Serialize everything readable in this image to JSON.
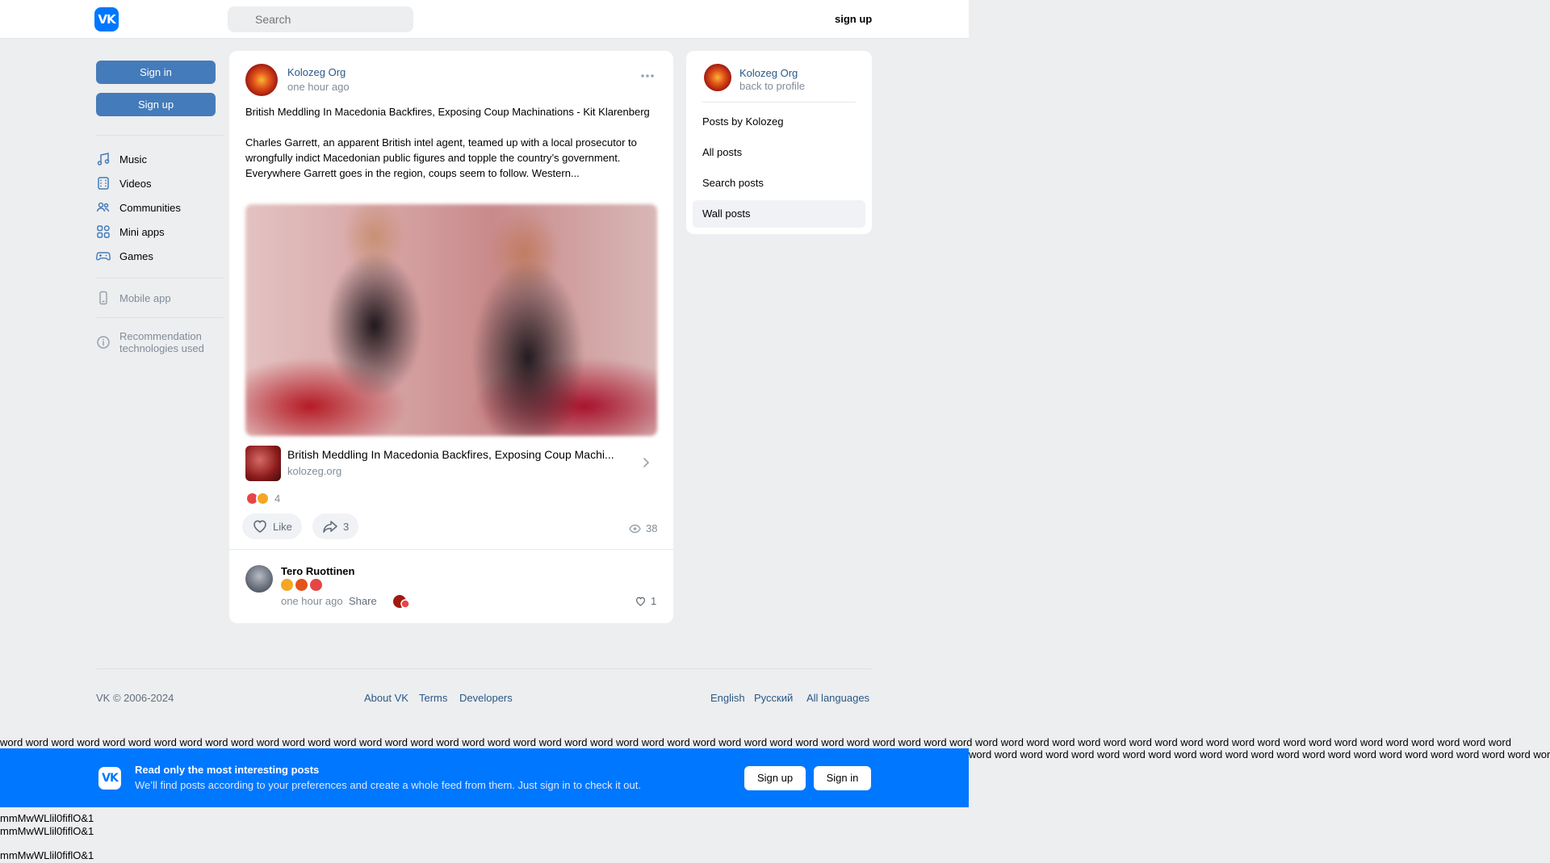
{
  "header": {
    "logo": "VK",
    "search_placeholder": "Search",
    "signup": "sign up"
  },
  "left_nav": {
    "sign_in": "Sign in",
    "sign_up": "Sign up",
    "items": [
      {
        "label": "Music",
        "icon": "music-icon"
      },
      {
        "label": "Videos",
        "icon": "videos-icon"
      },
      {
        "label": "Communities",
        "icon": "communities-icon"
      },
      {
        "label": "Mini apps",
        "icon": "mini-apps-icon"
      },
      {
        "label": "Games",
        "icon": "games-icon"
      }
    ],
    "mobile_app": "Mobile app",
    "recommendation_line1": "Recommendation",
    "recommendation_line2": "technologies used"
  },
  "post": {
    "author": "Kolozeg Org",
    "time": "one hour ago",
    "title_text": "British Meddling In Macedonia Backfires, Exposing Coup Machinations - Kit Klarenberg",
    "body_text": "Charles Garrett, an apparent British intel agent, teamed up with a local prosecutor to wrongfully indict Macedonian public figures and topple the country’s government. Everywhere Garrett goes in the region, coups seem to follow. Western...",
    "link_title": "British Meddling In Macedonia Backfires, Exposing Coup Machi...",
    "link_domain": "kolozeg.org",
    "reaction_count": "4",
    "like_label": "Like",
    "share_count": "3",
    "views": "38",
    "comment": {
      "name": "Tero Ruottinen",
      "time": "one hour ago",
      "share": "Share",
      "likes": "1"
    }
  },
  "profile_card": {
    "name": "Kolozeg Org",
    "back": "back to profile",
    "items": [
      "Posts by Kolozeg",
      "All posts",
      "Search posts",
      "Wall posts"
    ]
  },
  "footer": {
    "copyright": "VK © 2006-2024",
    "links": [
      "About VK",
      "Terms",
      "Developers"
    ],
    "languages": [
      "English",
      "Русский",
      "All languages"
    ]
  },
  "overflow": {
    "words_row1": "word word word word word word word word word word word word word word word word word word word word word word word word word word word word word word word word word word word word word word word word word word word word word word word word word word word word word word word word word word word",
    "words_row2": "word word word word word word word word word word word word word word word word word word word word word word word word word word word word word word word word word word word word word word word word word word word",
    "mono_line": "mmMwWLlil0fiflO&1"
  },
  "banner": {
    "logo": "VK",
    "title": "Read only the most interesting posts",
    "subtitle": "We’ll find posts according to your preferences and create a whole feed from them. Just sign in to check it out.",
    "sign_up": "Sign up",
    "sign_in": "Sign in"
  }
}
